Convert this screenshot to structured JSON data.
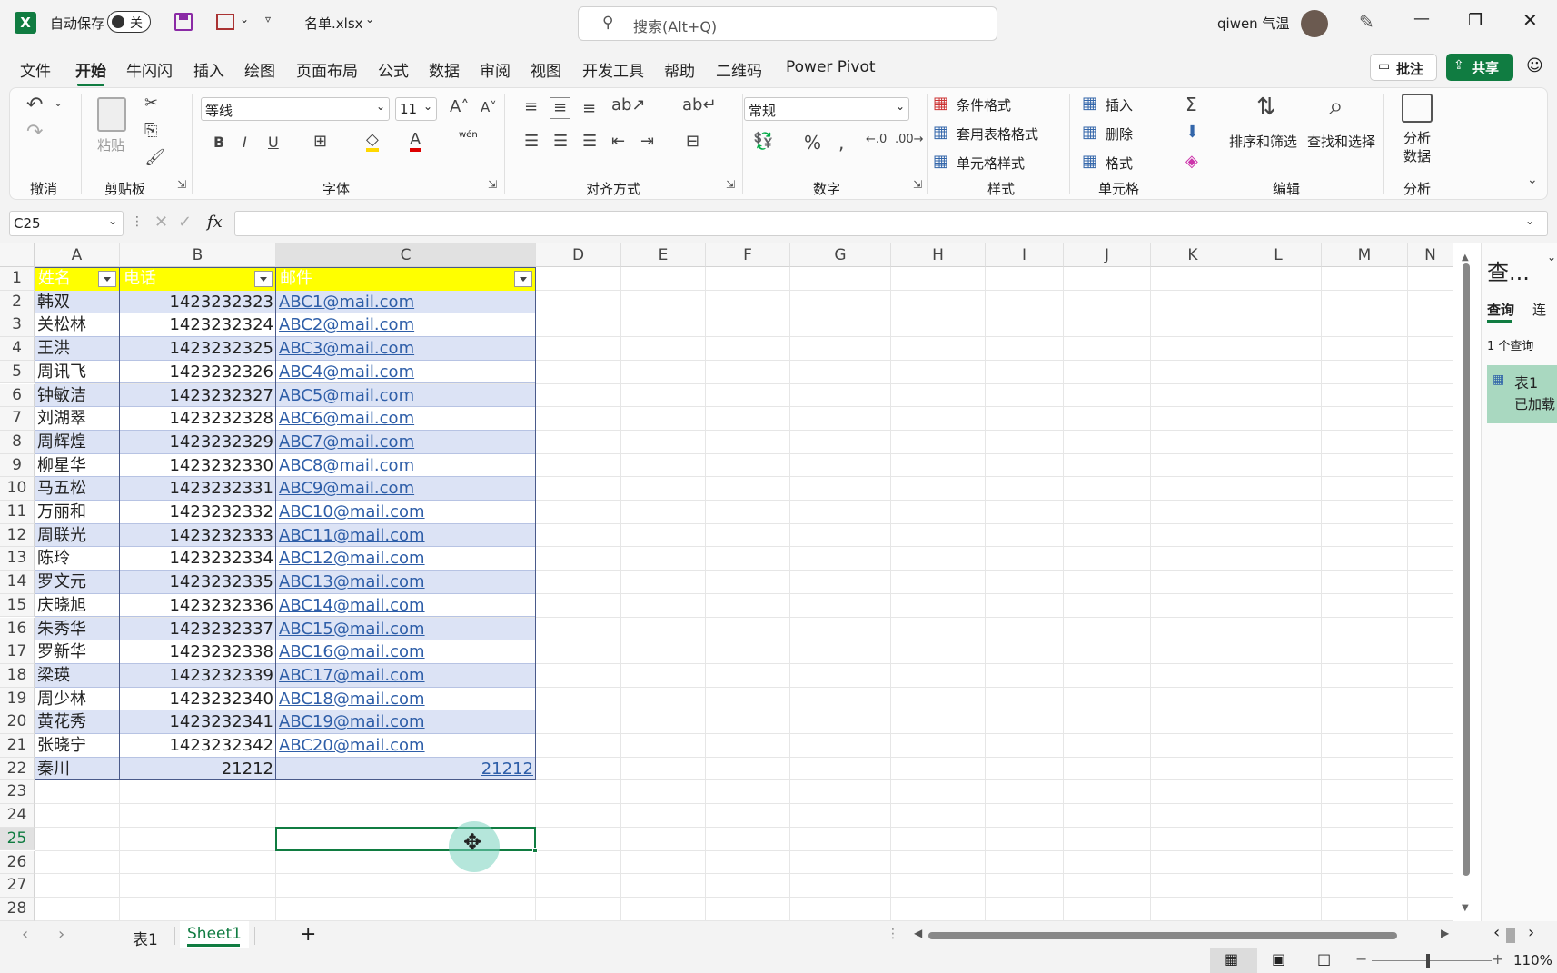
{
  "titlebar": {
    "autosave_label": "自动保存",
    "autosave_state": "关",
    "file_name": "名单.xlsx",
    "search_placeholder": "搜索(Alt+Q)",
    "user_name": "qiwen 气温"
  },
  "menubar": {
    "tabs": [
      "文件",
      "开始",
      "牛闪闪",
      "插入",
      "绘图",
      "页面布局",
      "公式",
      "数据",
      "审阅",
      "视图",
      "开发工具",
      "帮助",
      "二维码",
      "Power Pivot"
    ],
    "comments_label": "批注",
    "share_label": "共享"
  },
  "ribbon": {
    "undo_group": "撤消",
    "paste_label": "粘贴",
    "clipboard_group": "剪贴板",
    "font_name": "等线",
    "font_size": "11",
    "font_group": "字体",
    "align_group": "对齐方式",
    "number_format": "常规",
    "number_group": "数字",
    "cond_format": "条件格式",
    "table_format": "套用表格格式",
    "cell_style": "单元格样式",
    "styles_group": "样式",
    "insert_label": "插入",
    "delete_label": "删除",
    "format_label": "格式",
    "cells_group": "单元格",
    "sort_filter": "排序和筛选",
    "find_select": "查找和选择",
    "edit_group": "编辑",
    "analyze_data_1": "分析",
    "analyze_data_2": "数据",
    "analyze_group": "分析",
    "phonetic_label": "wén"
  },
  "formula_bar": {
    "name_box": "C25",
    "fx": "fx",
    "formula": ""
  },
  "sheet": {
    "columns": [
      "A",
      "B",
      "C",
      "D",
      "E",
      "F",
      "G",
      "H",
      "I",
      "J",
      "K",
      "L",
      "M",
      "N"
    ],
    "headers": [
      "姓名",
      "电话",
      "邮件"
    ],
    "rows": [
      {
        "name": "韩双",
        "phone": "1423232323",
        "email": "ABC1@mail.com"
      },
      {
        "name": "关松林",
        "phone": "1423232324",
        "email": "ABC2@mail.com"
      },
      {
        "name": "王洪",
        "phone": "1423232325",
        "email": "ABC3@mail.com"
      },
      {
        "name": "周讯飞",
        "phone": "1423232326",
        "email": "ABC4@mail.com"
      },
      {
        "name": "钟敏洁",
        "phone": "1423232327",
        "email": "ABC5@mail.com"
      },
      {
        "name": "刘湖翠",
        "phone": "1423232328",
        "email": "ABC6@mail.com"
      },
      {
        "name": "周辉煌",
        "phone": "1423232329",
        "email": "ABC7@mail.com"
      },
      {
        "name": "柳星华",
        "phone": "1423232330",
        "email": "ABC8@mail.com"
      },
      {
        "name": "马五松",
        "phone": "1423232331",
        "email": "ABC9@mail.com"
      },
      {
        "name": "万丽和",
        "phone": "1423232332",
        "email": "ABC10@mail.com"
      },
      {
        "name": "周联光",
        "phone": "1423232333",
        "email": "ABC11@mail.com"
      },
      {
        "name": "陈玲",
        "phone": "1423232334",
        "email": "ABC12@mail.com"
      },
      {
        "name": "罗文元",
        "phone": "1423232335",
        "email": "ABC13@mail.com"
      },
      {
        "name": "庆晓旭",
        "phone": "1423232336",
        "email": "ABC14@mail.com"
      },
      {
        "name": "朱秀华",
        "phone": "1423232337",
        "email": "ABC15@mail.com"
      },
      {
        "name": "罗新华",
        "phone": "1423232338",
        "email": "ABC16@mail.com"
      },
      {
        "name": "梁瑛",
        "phone": "1423232339",
        "email": "ABC17@mail.com"
      },
      {
        "name": "周少林",
        "phone": "1423232340",
        "email": "ABC18@mail.com"
      },
      {
        "name": "黄花秀",
        "phone": "1423232341",
        "email": "ABC19@mail.com"
      },
      {
        "name": "张晓宁",
        "phone": "1423232342",
        "email": "ABC20@mail.com"
      },
      {
        "name": "秦川",
        "phone": "21212",
        "email": "21212"
      }
    ],
    "row_numbers": [
      "1",
      "2",
      "3",
      "4",
      "5",
      "6",
      "7",
      "8",
      "9",
      "10",
      "11",
      "12",
      "13",
      "14",
      "15",
      "16",
      "17",
      "18",
      "19",
      "20",
      "21",
      "22",
      "23",
      "24",
      "25",
      "26",
      "27",
      "28"
    ]
  },
  "taskpane": {
    "title": "查...",
    "tab_query": "查询",
    "tab_connect": "连",
    "count": "1 个查询",
    "item_name": "表1",
    "item_status": "已加载"
  },
  "sheetbar": {
    "tabs": [
      "表1",
      "Sheet1"
    ],
    "active_tab": "Sheet1"
  },
  "statusbar": {
    "zoom": "110%"
  },
  "colors": {
    "excel_green": "#107c41",
    "header_yellow": "#ffff00",
    "band_blue": "#dce3f5"
  }
}
